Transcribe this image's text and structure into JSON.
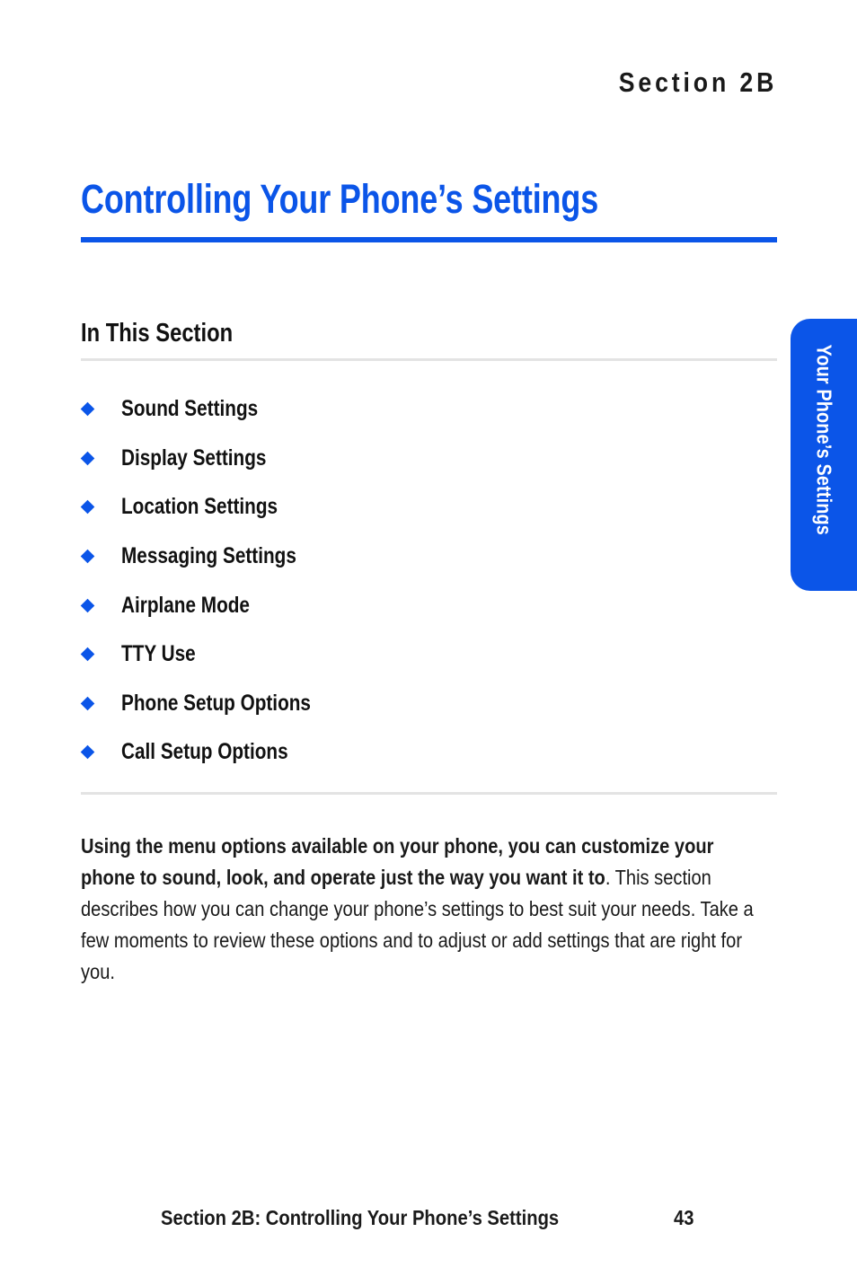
{
  "colors": {
    "accent_blue": "#0B55E8",
    "tab_blue": "#0B55E8",
    "rule_gray": "#E3E3E3",
    "text_black": "#1A1A1A",
    "tab_text": "#FFFFFF"
  },
  "header": {
    "running_head": "Section 2B"
  },
  "title": {
    "text": "Controlling Your Phone’s Settings"
  },
  "section": {
    "heading": "In This Section",
    "items": [
      {
        "label": "Sound Settings"
      },
      {
        "label": "Display Settings"
      },
      {
        "label": "Location Settings"
      },
      {
        "label": "Messaging Settings"
      },
      {
        "label": "Airplane Mode"
      },
      {
        "label": "TTY Use"
      },
      {
        "label": "Phone Setup Options"
      },
      {
        "label": "Call Setup Options"
      }
    ]
  },
  "intro": {
    "bold_lead": "Using the menu options available on your phone, you can customize your phone to sound, look, and operate just the way you want it to",
    "rest": ". This section describes how you can change your phone’s settings to best suit your needs. Take a few moments to review these options and to adjust or add settings that are right for you."
  },
  "side_tab": {
    "label": "Your Phone’s Settings"
  },
  "footer": {
    "title": "Section 2B: Controlling Your Phone’s Settings",
    "page_number": "43"
  }
}
